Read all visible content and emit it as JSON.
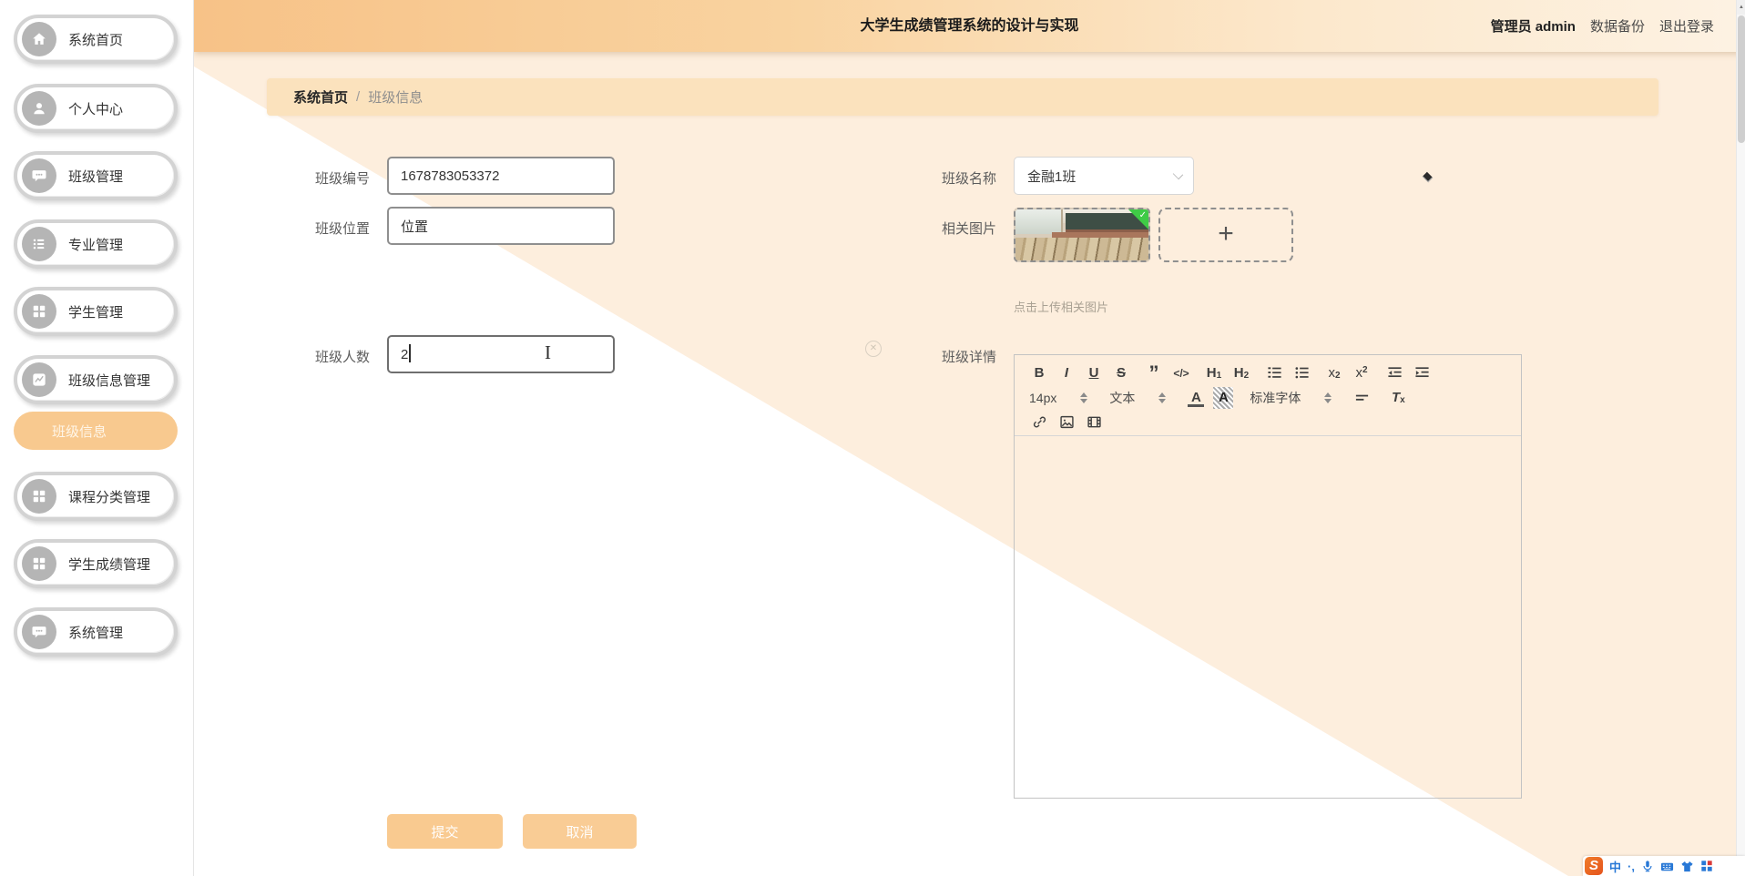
{
  "header": {
    "title": "大学生成绩管理系统的设计与实现",
    "admin_label": "管理员 admin",
    "backup_label": "数据备份",
    "logout_label": "退出登录"
  },
  "sidebar": {
    "items": [
      {
        "label": "系统首页",
        "icon": "home",
        "active": false
      },
      {
        "label": "个人中心",
        "icon": "user",
        "active": false
      },
      {
        "label": "班级管理",
        "icon": "chat-bubble",
        "active": false
      },
      {
        "label": "专业管理",
        "icon": "list",
        "active": false
      },
      {
        "label": "学生管理",
        "icon": "grid",
        "active": false
      },
      {
        "label": "班级信息管理",
        "icon": "chart",
        "active": false
      },
      {
        "label": "班级信息",
        "icon": "none",
        "active": true
      },
      {
        "label": "课程分类管理",
        "icon": "grid",
        "active": false
      },
      {
        "label": "学生成绩管理",
        "icon": "grid",
        "active": false
      },
      {
        "label": "系统管理",
        "icon": "chat-bubble",
        "active": false
      }
    ]
  },
  "breadcrumb": {
    "home": "系统首页",
    "separator": "/",
    "current": "班级信息"
  },
  "form": {
    "class_number": {
      "label": "班级编号",
      "value": "1678783053372"
    },
    "class_location": {
      "label": "班级位置",
      "value": "位置"
    },
    "class_size": {
      "label": "班级人数",
      "value": "2"
    },
    "class_name": {
      "label": "班级名称",
      "value": "金融1班"
    },
    "related_images": {
      "label": "相关图片",
      "hint": "点击上传相关图片"
    },
    "class_details": {
      "label": "班级详情"
    }
  },
  "editor": {
    "toolbar": {
      "bold": "B",
      "italic": "I",
      "underline": "U",
      "strike": "S",
      "quote": "”",
      "code": "</>",
      "h_letter": "H",
      "h1_num": "1",
      "h2_num": "2",
      "x_letter": "x",
      "sub_num": "2",
      "sup_num": "2",
      "font_size": "14px",
      "text_style": "文本",
      "font_family": "标准字体",
      "color_letter": "A",
      "bg_letter": "A",
      "clean_letter": "T",
      "clean_sub": "x"
    }
  },
  "buttons": {
    "submit": "提交",
    "cancel": "取消"
  },
  "ime": {
    "logo": "S",
    "mode": "中",
    "punct": "·,"
  },
  "colors": {
    "accent_orange": "#f8c98f",
    "header_gradient_left": "#f7c287",
    "header_gradient_right": "#fdf2e3",
    "content_peach": "#fdeedd",
    "breadcrumb_bg": "#fbe2bd",
    "badge_green": "#3fcb46",
    "ime_blue": "#2878d6"
  }
}
